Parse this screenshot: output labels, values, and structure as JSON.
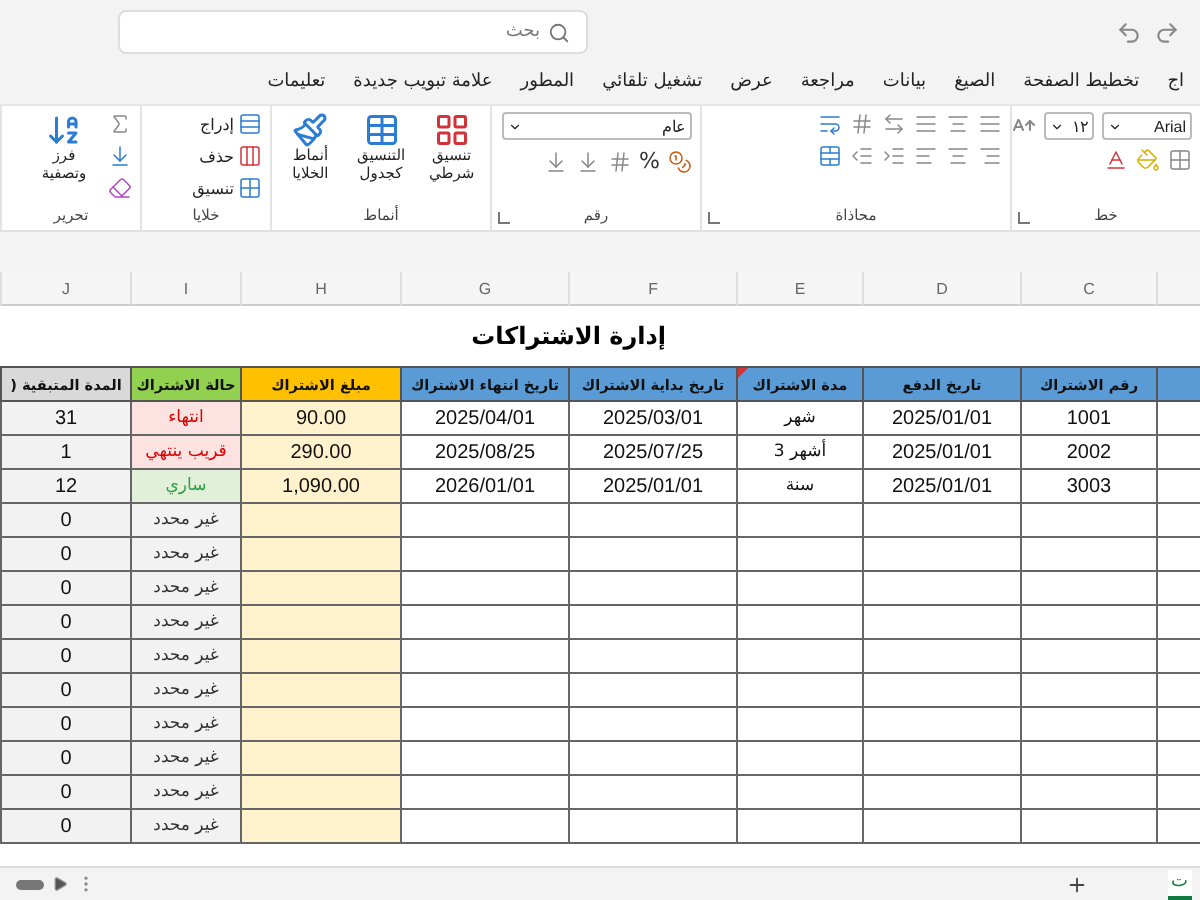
{
  "search": {
    "placeholder": "بحث"
  },
  "ribbon_tabs": [
    {
      "label": "اج",
      "selected": false
    },
    {
      "label": "تخطيط الصفحة",
      "selected": false
    },
    {
      "label": "الصيغ",
      "selected": false
    },
    {
      "label": "بيانات",
      "selected": false
    },
    {
      "label": "مراجعة",
      "selected": false
    },
    {
      "label": "عرض",
      "selected": false
    },
    {
      "label": "تشغيل تلقائي",
      "selected": false
    },
    {
      "label": "المطور",
      "selected": false
    },
    {
      "label": "علامة تبويب جديدة",
      "selected": false
    },
    {
      "label": "تعليمات",
      "selected": false
    }
  ],
  "ribbon": {
    "font": {
      "label": "خط",
      "font_name": "Arial",
      "font_size": "١٢"
    },
    "alignment": {
      "label": "محاذاة"
    },
    "number": {
      "label": "رقم",
      "format": "عام",
      "percent": "%"
    },
    "styles": {
      "label": "أنماط",
      "buttons": [
        "تنسيق شرطي",
        "التنسيق كجدول",
        "أنماط الخلايا"
      ]
    },
    "cells": {
      "label": "خلايا",
      "buttons": [
        "إدراج",
        "حذف",
        "تنسيق"
      ]
    },
    "editing": {
      "label": "تحرير",
      "sort_filter": "فرز وتصفية"
    }
  },
  "sheet": {
    "title": "إدارة الاشتراكات",
    "column_letters": [
      "C",
      "D",
      "E",
      "F",
      "G",
      "H",
      "I",
      "J"
    ],
    "headers": [
      {
        "color": "#5b9bd5"
      },
      {
        "text": "رقم الاشتراك",
        "color": "#5b9bd5",
        "has_comment": false
      },
      {
        "text": "تاريخ الدفع",
        "color": "#5b9bd5",
        "has_comment": false
      },
      {
        "text": "مدة الاشتراك",
        "color": "#5b9bd5",
        "has_comment": true
      },
      {
        "text": "تاريخ بداية الاشتراك",
        "color": "#5b9bd5",
        "has_comment": false
      },
      {
        "text": "تاريخ انتهاء الاشتراك",
        "color": "#5b9bd5",
        "has_comment": false
      },
      {
        "text": "مبلغ الاشتراك",
        "color": "#ffc000",
        "has_comment": false
      },
      {
        "text": "حالة الاشتراك",
        "color": "#92d050",
        "has_comment": false
      },
      {
        "text": "المدة المتبقية (",
        "color": "#d9d9d9",
        "has_comment": false
      }
    ],
    "rows": [
      {
        "id": "1001",
        "payment_date": "2025/01/01",
        "duration": "شهر",
        "start": "2025/03/01",
        "end": "2025/04/01",
        "amount": "90.00",
        "status": {
          "text": "انتهاء",
          "kind": "expired"
        },
        "remaining": "31"
      },
      {
        "id": "2002",
        "payment_date": "2025/01/01",
        "duration": "أشهر 3",
        "start": "2025/07/25",
        "end": "2025/08/25",
        "amount": "290.00",
        "status": {
          "text": "قريب ينتهي",
          "kind": "soon"
        },
        "remaining": "1"
      },
      {
        "id": "3003",
        "payment_date": "2025/01/01",
        "duration": "سنة",
        "start": "2025/01/01",
        "end": "2026/01/01",
        "amount": "1,090.00",
        "status": {
          "text": "ساري",
          "kind": "active"
        },
        "remaining": "12"
      },
      {
        "status": {
          "text": "غير محدد",
          "kind": "undefined"
        },
        "remaining": "0"
      },
      {
        "status": {
          "text": "غير محدد",
          "kind": "undefined"
        },
        "remaining": "0"
      },
      {
        "status": {
          "text": "غير محدد",
          "kind": "undefined"
        },
        "remaining": "0"
      },
      {
        "status": {
          "text": "غير محدد",
          "kind": "undefined"
        },
        "remaining": "0"
      },
      {
        "status": {
          "text": "غير محدد",
          "kind": "undefined"
        },
        "remaining": "0"
      },
      {
        "status": {
          "text": "غير محدد",
          "kind": "undefined"
        },
        "remaining": "0"
      },
      {
        "status": {
          "text": "غير محدد",
          "kind": "undefined"
        },
        "remaining": "0"
      },
      {
        "status": {
          "text": "غير محدد",
          "kind": "undefined"
        },
        "remaining": "0"
      },
      {
        "status": {
          "text": "غير محدد",
          "kind": "undefined"
        },
        "remaining": "0"
      },
      {
        "status": {
          "text": "غير محدد",
          "kind": "undefined"
        },
        "remaining": "0"
      }
    ]
  },
  "sheet_tab": {
    "label": "ت"
  }
}
